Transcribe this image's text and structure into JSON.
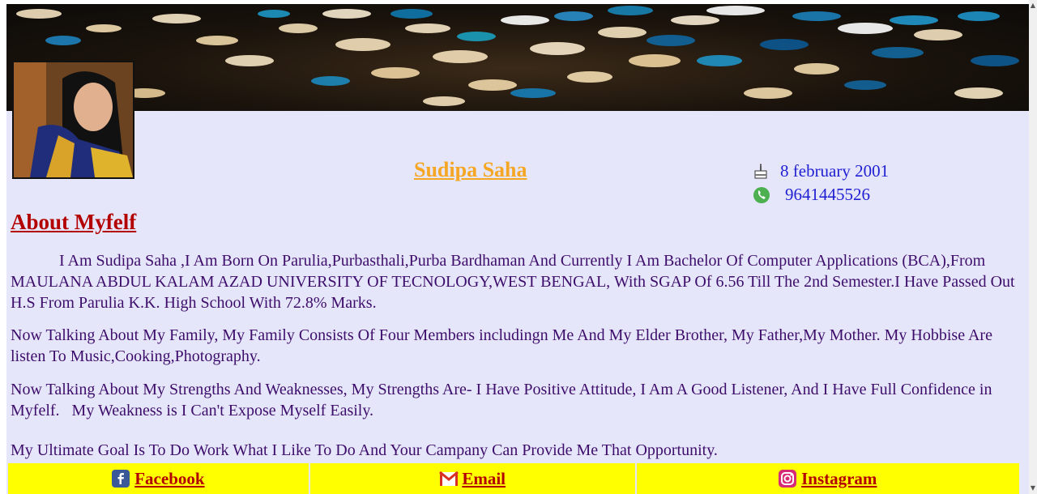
{
  "profile": {
    "name": "Sudipa Saha",
    "dob": "8 february 2001",
    "phone": "9641445526"
  },
  "about": {
    "title": "About Myfelf",
    "paragraphs": [
      "            I Am Sudipa Saha ,I Am Born On Parulia,Purbasthali,Purba Bardhaman And Currently I Am Bachelor Of Computer Applications (BCA),From MAULANA ABDUL KALAM AZAD UNIVERSITY OF TECNOLOGY,WEST BENGAL, With SGAP Of 6.56 Till The 2nd Semester.I Have Passed Out H.S From Parulia K.K. High School With 72.8% Marks.",
      "Now Talking About My Family, My Family Consists Of Four Members includingn Me And My Elder Brother, My Father,My Mother. My Hobbise Are listen To Music,Cooking,Photography.",
      "Now Talking About My Strengths And Weaknesses, My Strengths Are- I Have Positive Attitude, I Am A Good Listener, And I Have Full Confidence in Myfelf.   My Weakness is I Can't Expose Myself Easily.",
      "My Ultimate Goal Is To Do Work What I Like To Do And Your Campany Can Provide Me That Opportunity."
    ]
  },
  "footer": {
    "links": [
      {
        "label": "Facebook",
        "icon": "facebook-icon"
      },
      {
        "label": "Email",
        "icon": "gmail-icon"
      },
      {
        "label": "Instagram ",
        "icon": "instagram-icon"
      }
    ]
  },
  "colors": {
    "page_bg": "#e6e6fa",
    "name": "#f5a623",
    "contact": "#1e1ed2",
    "heading": "#b30000",
    "body_text": "#3d0d6b",
    "footer_bg": "#ffff00"
  }
}
